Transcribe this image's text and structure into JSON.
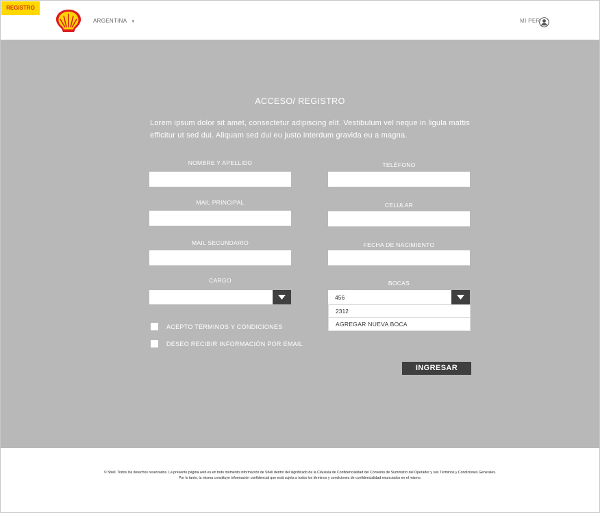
{
  "header": {
    "tag_label": "REGISTRO",
    "country": "ARGENTINA",
    "profile_label": "MI PERFIL",
    "brand_colors": {
      "red": "#dd1d21",
      "yellow": "#ffd500"
    }
  },
  "main": {
    "title": "ACCESO/ REGISTRO",
    "intro": "Lorem ipsum dolor sit amet, consectetur adipiscing elit. Vestibulum vel neque in ligula mattis efficitur ut sed dui. Aliquam sed dui eu justo interdum gravida eu a magna.",
    "left_fields": [
      {
        "label": "NOMBRE Y APELLIDO",
        "value": ""
      },
      {
        "label": "MAIL PRINCIPAL",
        "value": ""
      },
      {
        "label": "MAIL SECUNDARIO",
        "value": ""
      }
    ],
    "right_fields": [
      {
        "label": "TELÉFONO",
        "value": ""
      },
      {
        "label": "CELULAR",
        "value": ""
      },
      {
        "label": "FECHA DE NACIMIENTO",
        "value": ""
      }
    ],
    "cargo": {
      "label": "CARGO",
      "value": ""
    },
    "bocas": {
      "label": "BOCAS",
      "value": "456",
      "options": [
        "2312"
      ],
      "add_label": "AGREGAR NUEVA BOCA"
    },
    "checkboxes": [
      {
        "label": "ACEPTO TÉRMINOS Y CONDICIONES",
        "checked": false
      },
      {
        "label": "DESEO RECIBIR INFORMACIÓN POR EMAIL",
        "checked": false
      }
    ],
    "submit_label": "INGRESAR",
    "background_color": "#b8b8b8"
  },
  "footer": {
    "line1": "© Shell. Todos los derechos reservados. La presente página web es en todo momento información de Shell dentro del significado de la Cláusula de Confidencialidad del Convenio de Suministro del Operador y sus Términos y Condiciones Generales.",
    "line2": "Por lo tanto, la misma constituye información confidencial que está sujeta a todos los términos y condiciones de confidencialidad enunciados en el mismo."
  }
}
